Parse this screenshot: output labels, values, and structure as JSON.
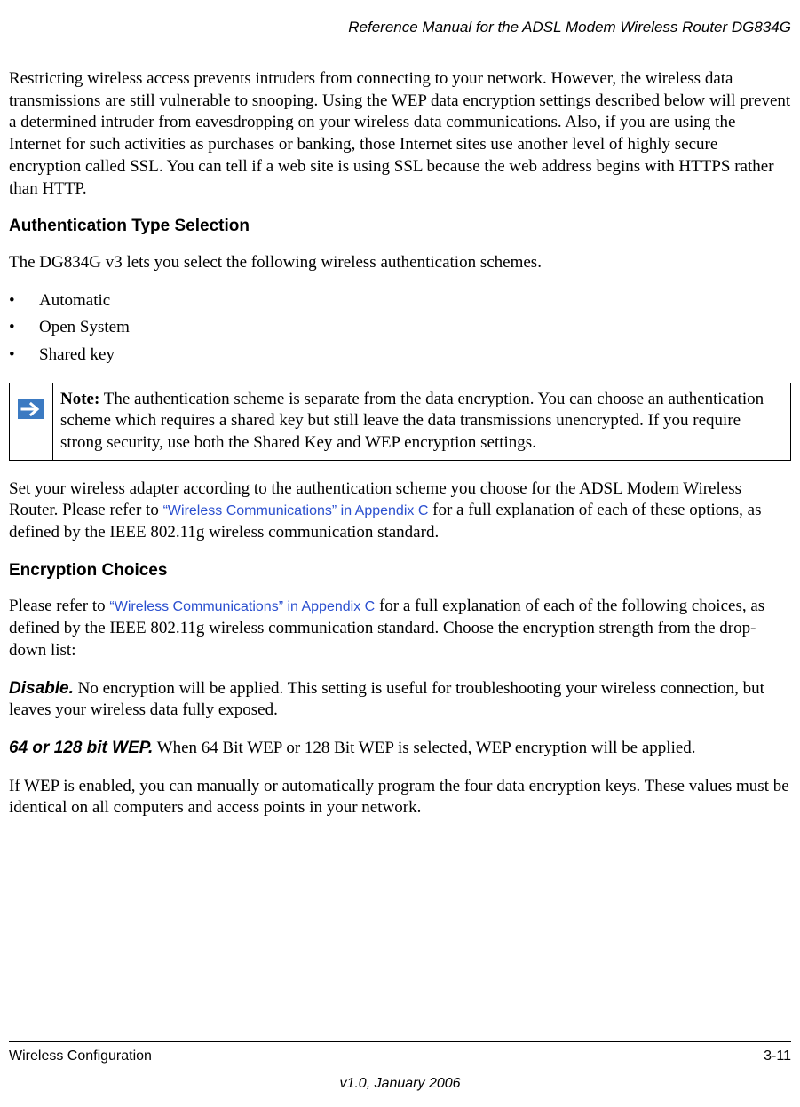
{
  "header": {
    "title": "Reference Manual for the ADSL Modem Wireless Router DG834G"
  },
  "intro_paragraph": "Restricting wireless access prevents intruders from connecting to your network. However, the wireless data transmissions are still vulnerable to snooping. Using the WEP data encryption settings described below will prevent a determined intruder from eavesdropping on your wireless data communications. Also, if you are using the Internet for such activities as purchases or banking, those Internet sites use another level of highly secure encryption called SSL. You can tell if a web site is using SSL because the web address begins with HTTPS rather than HTTP.",
  "auth_section": {
    "heading": "Authentication Type Selection",
    "lead": "The DG834G v3 lets you select the following wireless authentication schemes.",
    "bullets": [
      "Automatic",
      "Open System",
      "Shared key"
    ]
  },
  "note": {
    "label": "Note:",
    "body": " The authentication scheme is separate from the data encryption. You can choose an authentication scheme which requires a shared key but still leave the data transmissions unencrypted. If you require strong security, use both the Shared Key and WEP encryption settings."
  },
  "post_note": {
    "pre": "Set your wireless adapter according to the authentication scheme you choose for the ADSL Modem Wireless Router. Please refer to ",
    "link": "“Wireless Communications” in Appendix C",
    "post": " for a full explanation of each of these options, as defined by the IEEE 802.11g wireless communication standard."
  },
  "encryption_section": {
    "heading": "Encryption Choices",
    "lead_pre": "Please refer to ",
    "lead_link": "“Wireless Communications” in Appendix C",
    "lead_post": " for a full explanation of each of the following choices, as defined by the IEEE 802.11g wireless communication standard. Choose the encryption strength from the drop-down list:",
    "disable_label": "Disable.",
    "disable_body": " No encryption will be applied. This setting is useful for troubleshooting your wireless connection, but leaves your wireless data fully exposed.",
    "wep_label": "64 or 128 bit WEP.",
    "wep_body": " When 64 Bit WEP or 128 Bit WEP is selected, WEP encryption will be applied.",
    "wep_follow": "If WEP is enabled, you can manually or automatically program the four data encryption keys. These values must be identical on all computers and access points in your network."
  },
  "footer": {
    "left": "Wireless Configuration",
    "right": "3-11",
    "version": "v1.0, January 2006"
  }
}
